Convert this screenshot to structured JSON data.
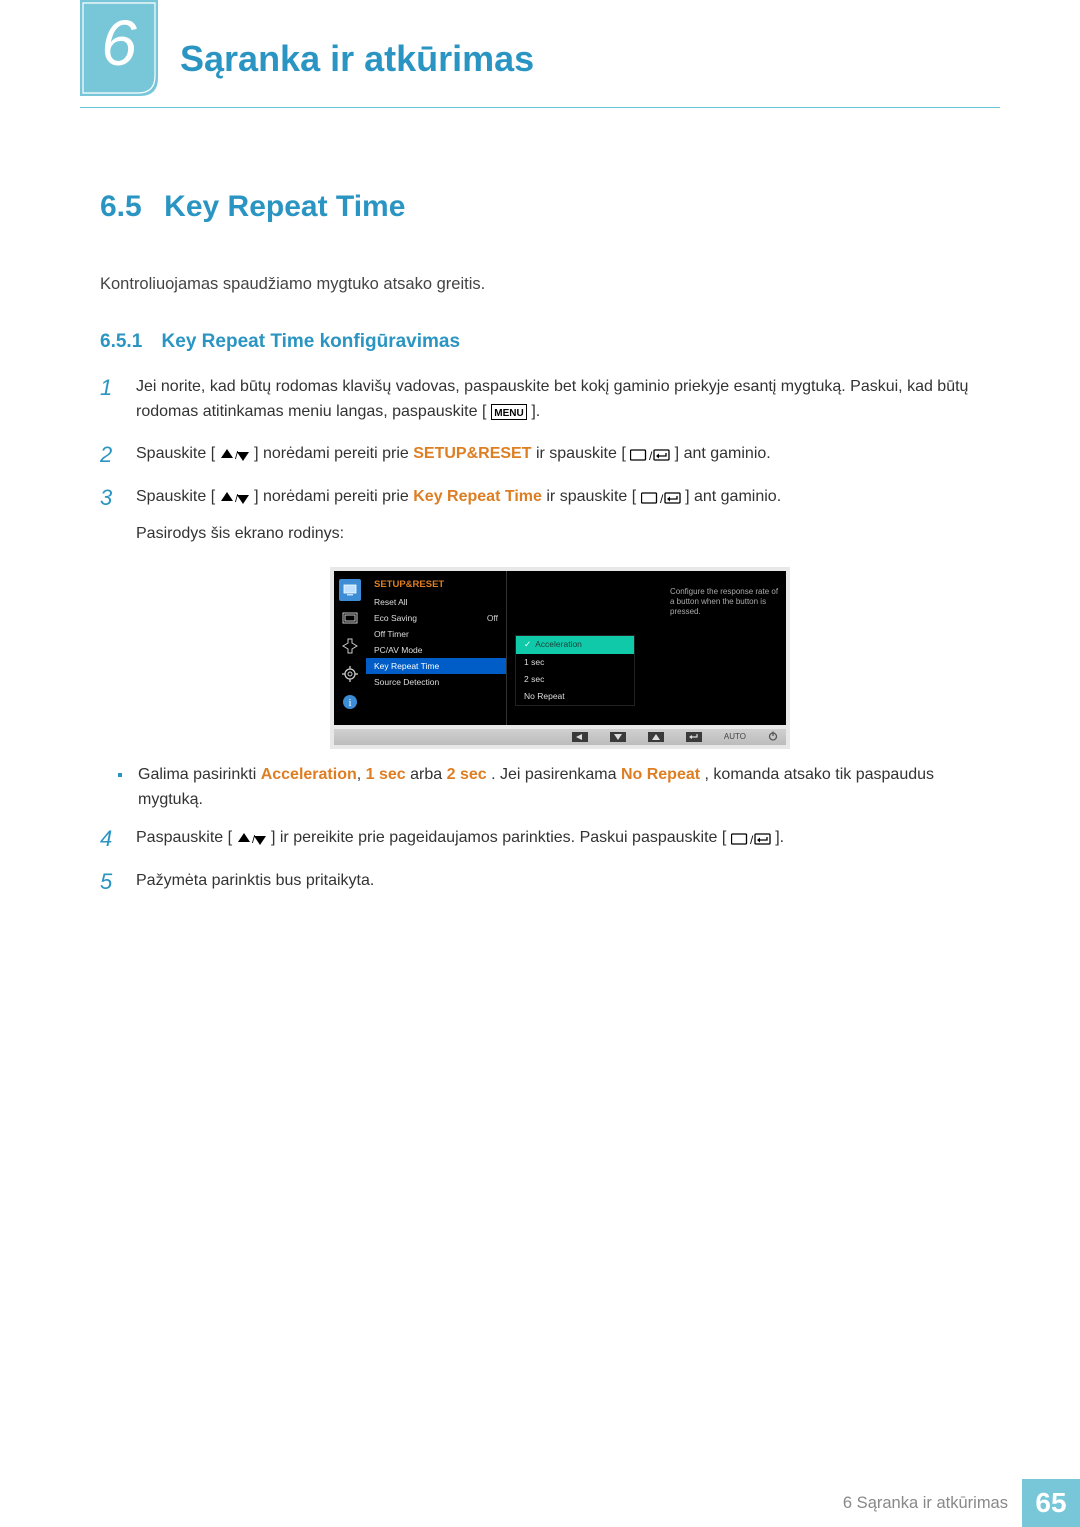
{
  "header": {
    "chapter_num": "6",
    "chapter_title": "Sąranka ir atkūrimas"
  },
  "section": {
    "number": "6.5",
    "title": "Key Repeat Time"
  },
  "intro": "Kontroliuojamas spaudžiamo mygtuko atsako greitis.",
  "subsection": {
    "number": "6.5.1",
    "title": "Key Repeat Time konfigūravimas"
  },
  "steps": {
    "s1": {
      "num": "1",
      "text_a": "Jei norite, kad būtų rodomas klavišų vadovas, paspauskite bet kokį gaminio priekyje esantį mygtuką. Paskui, kad būtų rodomas atitinkamas meniu langas, paspauskite [",
      "text_b": "]."
    },
    "s2": {
      "num": "2",
      "text_a": "Spauskite [",
      "text_b": "] norėdami pereiti prie ",
      "hl1": "SETUP&RESET",
      "text_c": " ir spauskite [",
      "text_d": "] ant gaminio."
    },
    "s3": {
      "num": "3",
      "text_a": "Spauskite [",
      "text_b": "] norėdami pereiti prie ",
      "hl1": "Key Repeat Time",
      "text_c": " ir spauskite [",
      "text_d": "] ant gaminio.",
      "extra": "Pasirodys šis ekrano rodinys:"
    },
    "bullet": {
      "text_a": "Galima pasirinkti ",
      "hl1": "Acceleration",
      "sep1": ", ",
      "hl2": "1 sec",
      "text_b": " arba ",
      "hl3": "2 sec",
      "text_c": ". Jei pasirenkama ",
      "hl4": "No Repeat",
      "text_d": ", komanda atsako tik paspaudus mygtuką."
    },
    "s4": {
      "num": "4",
      "text_a": "Paspauskite [",
      "text_b": "] ir pereikite prie pageidaujamos parinkties. Paskui paspauskite [",
      "text_c": "]."
    },
    "s5": {
      "num": "5",
      "text": "Pažymėta parinktis bus pritaikyta."
    }
  },
  "osd": {
    "title": "SETUP&RESET",
    "items": [
      {
        "label": "Reset All",
        "val": ""
      },
      {
        "label": "Eco Saving",
        "val": "Off"
      },
      {
        "label": "Off Timer",
        "val": ""
      },
      {
        "label": "PC/AV Mode",
        "val": ""
      },
      {
        "label": "Key Repeat Time",
        "val": ""
      },
      {
        "label": "Source Detection",
        "val": ""
      }
    ],
    "tip": "Configure the response rate of a button when the button is pressed.",
    "sub": [
      {
        "label": "Acceleration",
        "sel": true
      },
      {
        "label": "1 sec"
      },
      {
        "label": "2 sec"
      },
      {
        "label": "No Repeat"
      }
    ],
    "bar_auto": "AUTO"
  },
  "footer": {
    "text": "6 Sąranka ir atkūrimas",
    "page": "65"
  }
}
